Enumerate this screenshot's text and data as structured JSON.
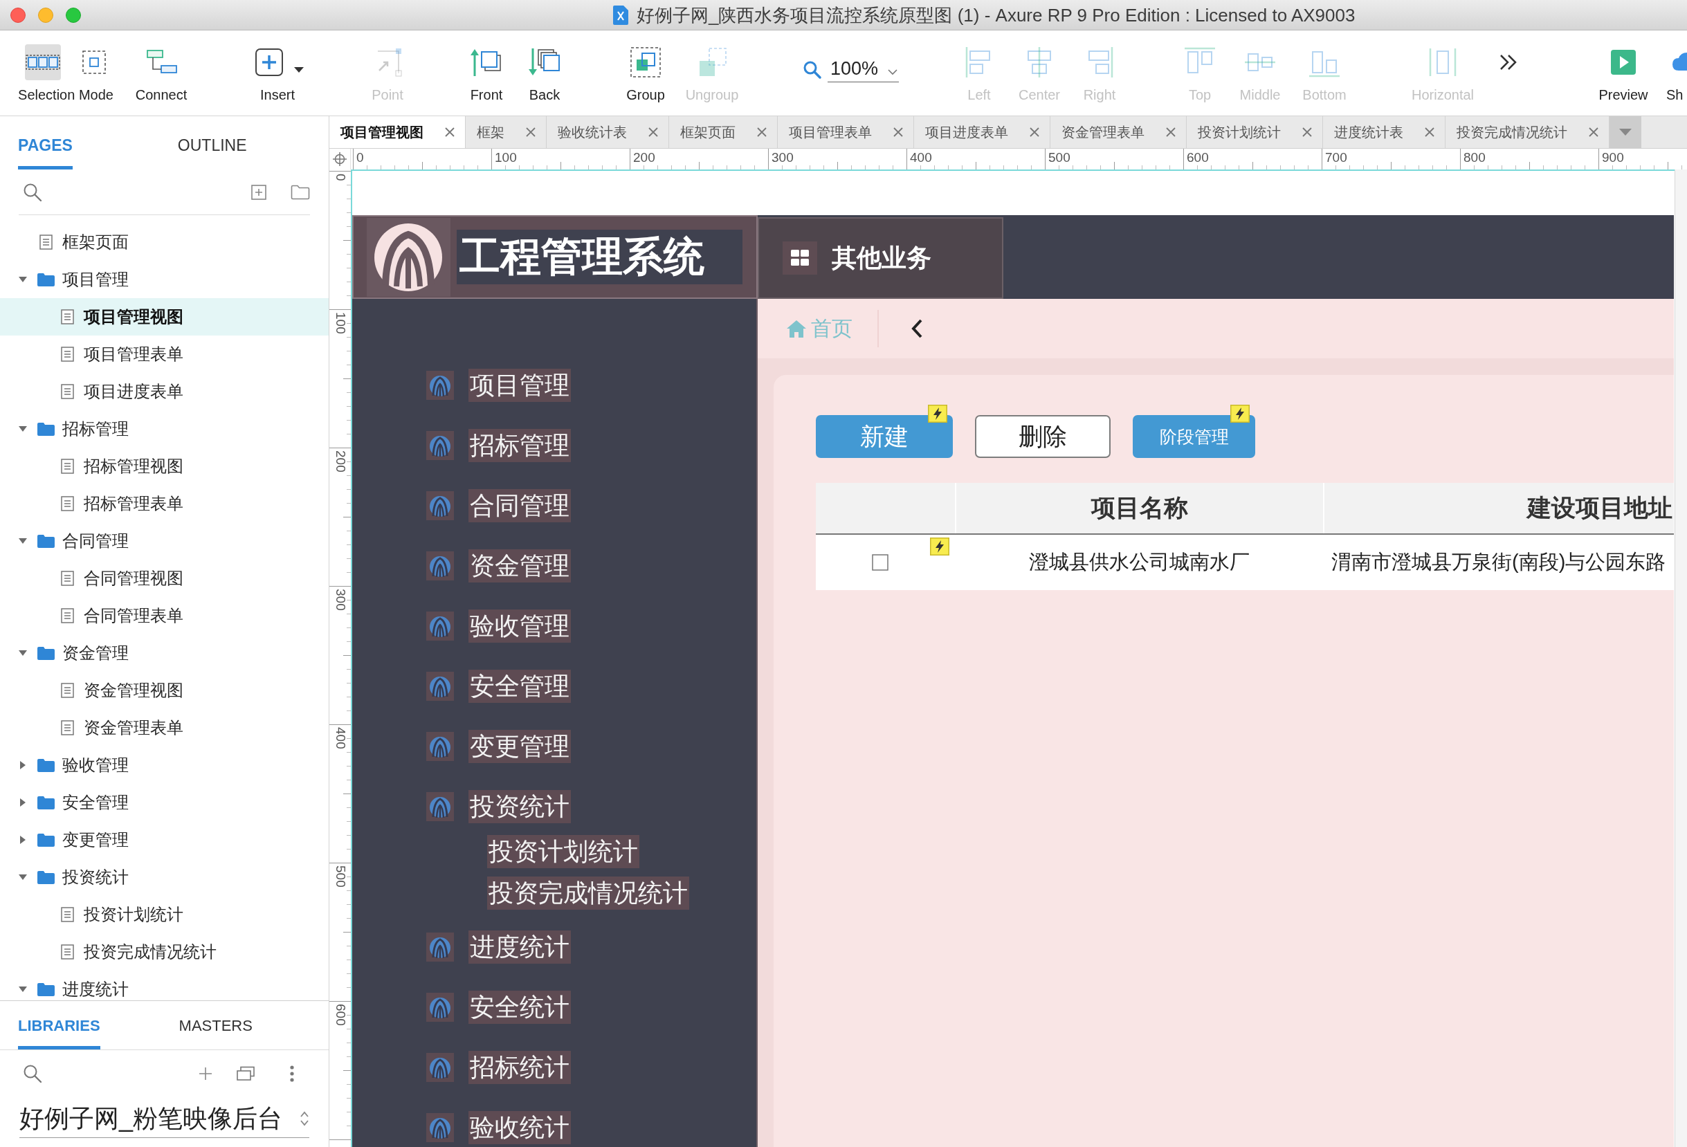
{
  "window": {
    "title": "好例子网_陕西水务项目流控系统原型图 (1) - Axure RP 9 Pro Edition : Licensed to AX9003"
  },
  "toolbar": {
    "items": [
      {
        "kind": "selection",
        "label": "Selection Mode",
        "selected": true,
        "disabled": false
      },
      {
        "kind": "connect",
        "label": "Connect",
        "selected": false,
        "disabled": false
      },
      {
        "kind": "insert",
        "label": "Insert",
        "selected": false,
        "disabled": false
      },
      {
        "kind": "point",
        "label": "Point",
        "selected": false,
        "disabled": true
      },
      {
        "kind": "front",
        "label": "Front",
        "selected": false,
        "disabled": false
      },
      {
        "kind": "back",
        "label": "Back",
        "selected": false,
        "disabled": false
      },
      {
        "kind": "group",
        "label": "Group",
        "selected": false,
        "disabled": false
      },
      {
        "kind": "ungroup",
        "label": "Ungroup",
        "selected": false,
        "disabled": true
      },
      {
        "kind": "zoom",
        "value": "100%"
      },
      {
        "kind": "align-left",
        "label": "Left",
        "selected": false,
        "disabled": true
      },
      {
        "kind": "align-center",
        "label": "Center",
        "selected": false,
        "disabled": true
      },
      {
        "kind": "align-right",
        "label": "Right",
        "selected": false,
        "disabled": true
      },
      {
        "kind": "align-top",
        "label": "Top",
        "selected": false,
        "disabled": true
      },
      {
        "kind": "align-middle",
        "label": "Middle",
        "selected": false,
        "disabled": true
      },
      {
        "kind": "align-bottom",
        "label": "Bottom",
        "selected": false,
        "disabled": true
      },
      {
        "kind": "distribute-horizontal",
        "label": "Horizontal",
        "selected": false,
        "disabled": true
      },
      {
        "kind": "overflow",
        "selected": false,
        "disabled": false
      },
      {
        "kind": "preview",
        "label": "Preview",
        "selected": false,
        "disabled": false
      },
      {
        "kind": "share",
        "label": "Sh",
        "selected": false,
        "disabled": false
      }
    ]
  },
  "pages_panel": {
    "tabs": [
      {
        "label": "PAGES",
        "selected": true
      },
      {
        "label": "OUTLINE",
        "selected": false
      }
    ],
    "tree": [
      {
        "kind": "page",
        "label": "框架页面",
        "selected": false
      },
      {
        "kind": "folder",
        "label": "项目管理",
        "selected": false,
        "expanded": true,
        "children": [
          {
            "kind": "page",
            "label": "项目管理视图",
            "selected": true
          },
          {
            "kind": "page",
            "label": "项目管理表单",
            "selected": false
          },
          {
            "kind": "page",
            "label": "项目进度表单",
            "selected": false
          }
        ]
      },
      {
        "kind": "folder",
        "label": "招标管理",
        "selected": false,
        "expanded": true,
        "children": [
          {
            "kind": "page",
            "label": "招标管理视图",
            "selected": false
          },
          {
            "kind": "page",
            "label": "招标管理表单",
            "selected": false
          }
        ]
      },
      {
        "kind": "folder",
        "label": "合同管理",
        "selected": false,
        "expanded": true,
        "children": [
          {
            "kind": "page",
            "label": "合同管理视图",
            "selected": false
          },
          {
            "kind": "page",
            "label": "合同管理表单",
            "selected": false
          }
        ]
      },
      {
        "kind": "folder",
        "label": "资金管理",
        "selected": false,
        "expanded": true,
        "children": [
          {
            "kind": "page",
            "label": "资金管理视图",
            "selected": false
          },
          {
            "kind": "page",
            "label": "资金管理表单",
            "selected": false
          }
        ]
      },
      {
        "kind": "folder",
        "label": "验收管理",
        "selected": false,
        "expanded": false
      },
      {
        "kind": "folder",
        "label": "安全管理",
        "selected": false,
        "expanded": false
      },
      {
        "kind": "folder",
        "label": "变更管理",
        "selected": false,
        "expanded": false
      },
      {
        "kind": "folder",
        "label": "投资统计",
        "selected": false,
        "expanded": true,
        "children": [
          {
            "kind": "page",
            "label": "投资计划统计",
            "selected": false
          },
          {
            "kind": "page",
            "label": "投资完成情况统计",
            "selected": false
          }
        ]
      },
      {
        "kind": "folder",
        "label": "进度统计",
        "selected": false,
        "expanded": true
      }
    ]
  },
  "libraries_panel": {
    "tabs": [
      {
        "label": "LIBRARIES",
        "selected": true
      },
      {
        "label": "MASTERS",
        "selected": false
      }
    ],
    "library": "好例子网_粉笔映像后台"
  },
  "doc_tabs": [
    {
      "label": "项目管理视图",
      "selected": true
    },
    {
      "label": "框架",
      "selected": false
    },
    {
      "label": "验收统计表",
      "selected": false
    },
    {
      "label": "框架页面",
      "selected": false
    },
    {
      "label": "项目管理表单",
      "selected": false
    },
    {
      "label": "项目进度表单",
      "selected": false
    },
    {
      "label": "资金管理表单",
      "selected": false
    },
    {
      "label": "投资计划统计",
      "selected": false
    },
    {
      "label": "进度统计表",
      "selected": false
    },
    {
      "label": "投资完成情况统计",
      "selected": false
    }
  ],
  "rulers": {
    "horizontal": [
      "0",
      "100",
      "200",
      "300",
      "400",
      "500",
      "600",
      "700",
      "800",
      "900"
    ],
    "vertical": [
      "0",
      "100",
      "200",
      "300",
      "400",
      "500",
      "600"
    ]
  },
  "prototype": {
    "system_title": "工程管理系统",
    "other_business": "其他业务",
    "menu": [
      {
        "label": "项目管理"
      },
      {
        "label": "招标管理"
      },
      {
        "label": "合同管理"
      },
      {
        "label": "资金管理"
      },
      {
        "label": "验收管理"
      },
      {
        "label": "安全管理"
      },
      {
        "label": "变更管理"
      },
      {
        "label": "投资统计",
        "children": [
          {
            "label": "投资计划统计"
          },
          {
            "label": "投资完成情况统计"
          }
        ]
      },
      {
        "label": "进度统计"
      },
      {
        "label": "安全统计"
      },
      {
        "label": "招标统计"
      },
      {
        "label": "验收统计"
      }
    ],
    "breadcrumb": "首页",
    "buttons": [
      {
        "label": "新建",
        "kind": "primary",
        "interaction": true
      },
      {
        "label": "删除",
        "kind": "outline",
        "interaction": false
      },
      {
        "label": "阶段管理",
        "kind": "compact",
        "interaction": true
      }
    ],
    "table": {
      "columns": [
        "项目名称",
        "建设项目地址"
      ],
      "rows": [
        {
          "checked": false,
          "interaction": true,
          "cells": [
            "澄城县供水公司城南水厂",
            "渭南市澄城县万泉街(南段)与公园东路"
          ]
        }
      ]
    }
  }
}
